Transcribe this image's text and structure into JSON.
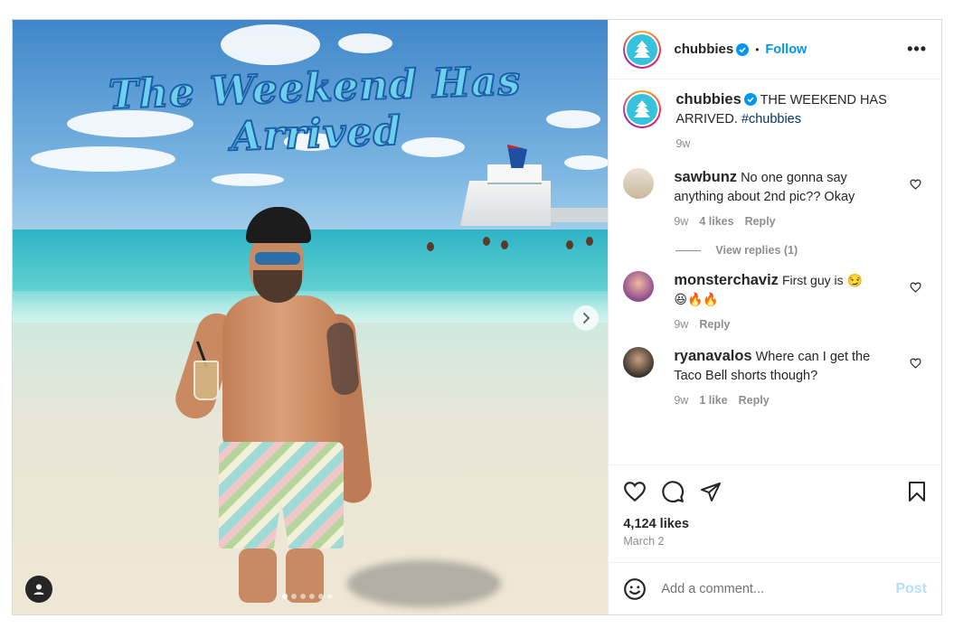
{
  "post": {
    "username": "chubbies",
    "follow_label": "Follow",
    "more_label": "•••",
    "caption_text": "THE WEEKEND HAS ARRIVED.",
    "caption_hashtag": "#chubbies",
    "caption_time": "9w",
    "image_text": "The Weekend Has Arrived",
    "likes": "4,124 likes",
    "date": "March 2",
    "comment_placeholder": "Add a comment...",
    "post_label": "Post"
  },
  "comments": [
    {
      "user": "sawbunz",
      "text": "No one gonna say anything about 2nd pic?? Okay",
      "time": "9w",
      "likes": "4 likes",
      "reply": "Reply",
      "view_replies": "View replies (1)"
    },
    {
      "user": "monsterchaviz",
      "text": "First guy is 😏",
      "text2": "😆🔥🔥",
      "time": "9w",
      "reply": "Reply"
    },
    {
      "user": "ryanavalos",
      "text": "Where can I get the Taco Bell shorts though?",
      "time": "9w",
      "likes": "1 like",
      "reply": "Reply"
    }
  ],
  "colors": {
    "accent": "#0095f6",
    "brand": "#36c2dd",
    "muted": "#8e8e8e"
  },
  "icons": [
    "verified-icon",
    "more-icon",
    "heart-icon",
    "comment-icon",
    "share-icon",
    "bookmark-icon",
    "emoji-icon",
    "chevron-right-icon",
    "user-tag-icon"
  ]
}
